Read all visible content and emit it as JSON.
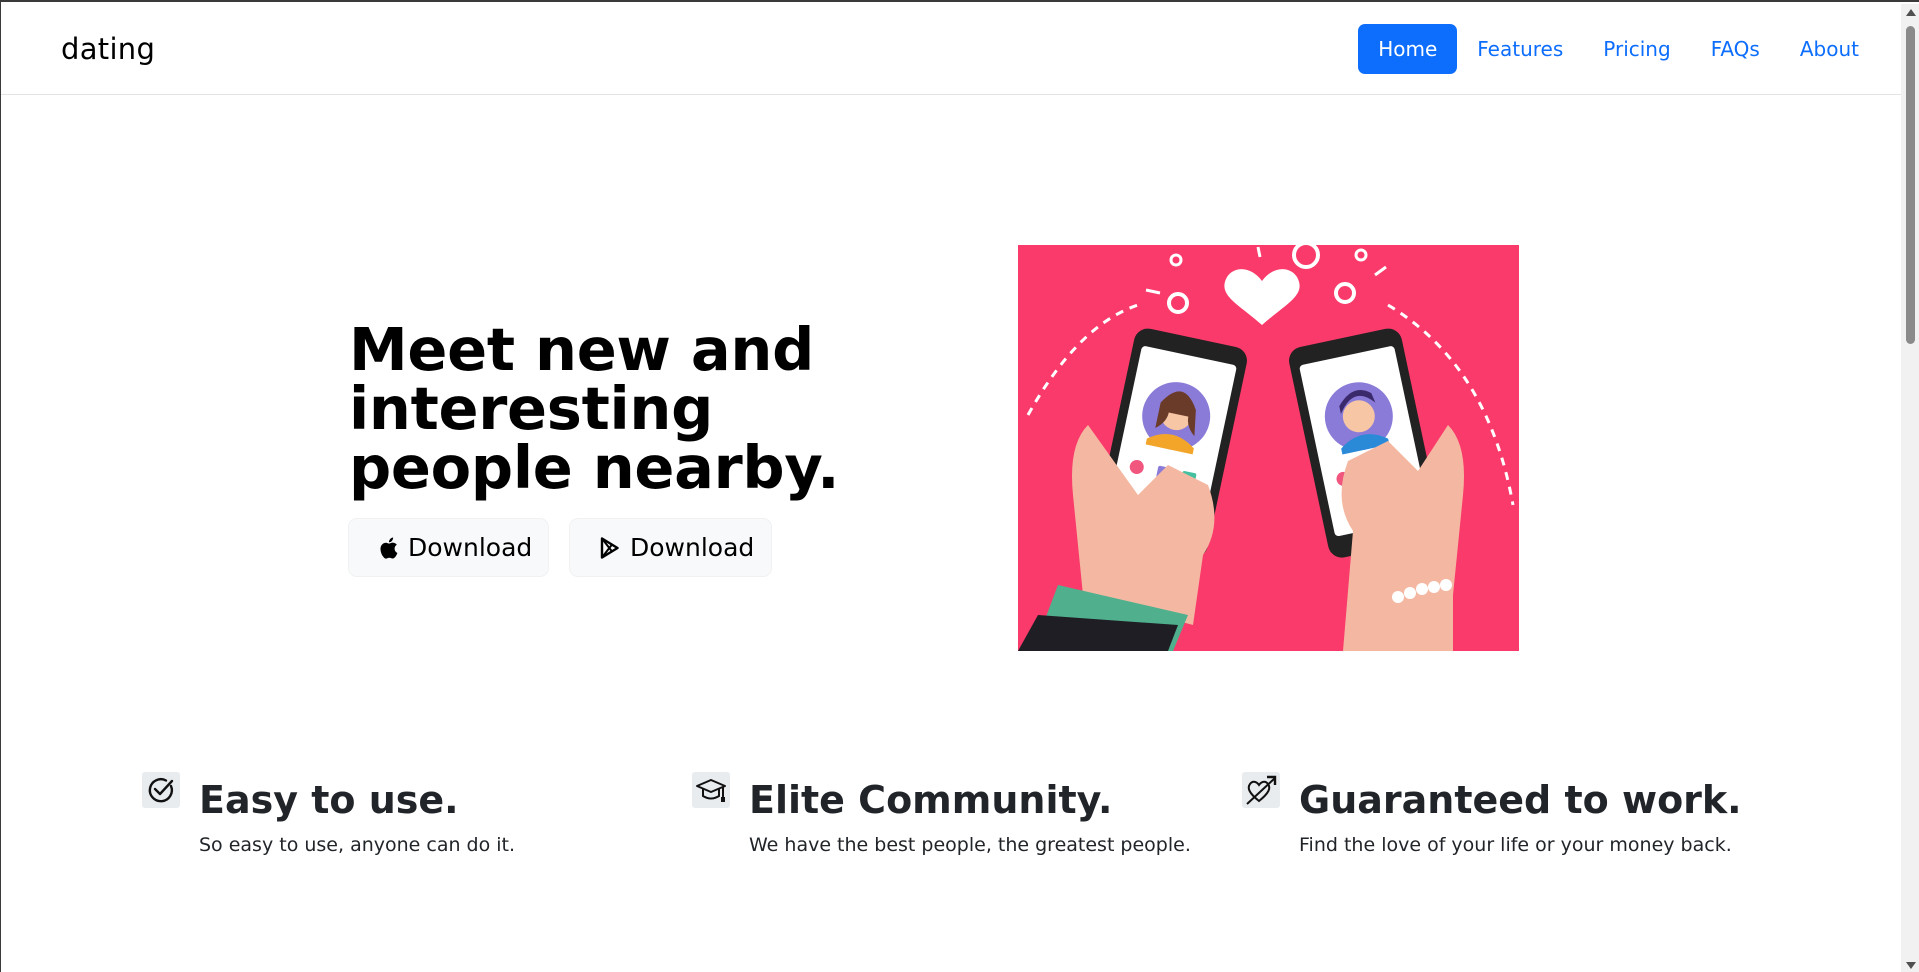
{
  "navbar": {
    "brand": "dating",
    "links": [
      {
        "label": "Home",
        "active": true
      },
      {
        "label": "Features",
        "active": false
      },
      {
        "label": "Pricing",
        "active": false
      },
      {
        "label": "FAQs",
        "active": false
      },
      {
        "label": "About",
        "active": false
      }
    ]
  },
  "hero": {
    "title": "Meet new and interesting people nearby.",
    "buttons": [
      {
        "label": "Download",
        "icon": "apple-icon"
      },
      {
        "label": "Download",
        "icon": "google-play-icon"
      }
    ],
    "illustration": {
      "icon": "two-phones-dating-illustration",
      "background": "#fa3a6a"
    }
  },
  "features": [
    {
      "icon": "check-circle-icon",
      "title": "Easy to use.",
      "description": "So easy to use, anyone can do it."
    },
    {
      "icon": "graduation-cap-icon",
      "title": "Elite Community.",
      "description": "We have the best people, the greatest people."
    },
    {
      "icon": "heart-arrow-icon",
      "title": "Guaranteed to work.",
      "description": "Find the love of your life or your money back."
    }
  ],
  "colors": {
    "primary": "#0d6efd",
    "hero_pink": "#fa3a6a",
    "button_bg": "#f8f9fa",
    "text": "#212529"
  }
}
